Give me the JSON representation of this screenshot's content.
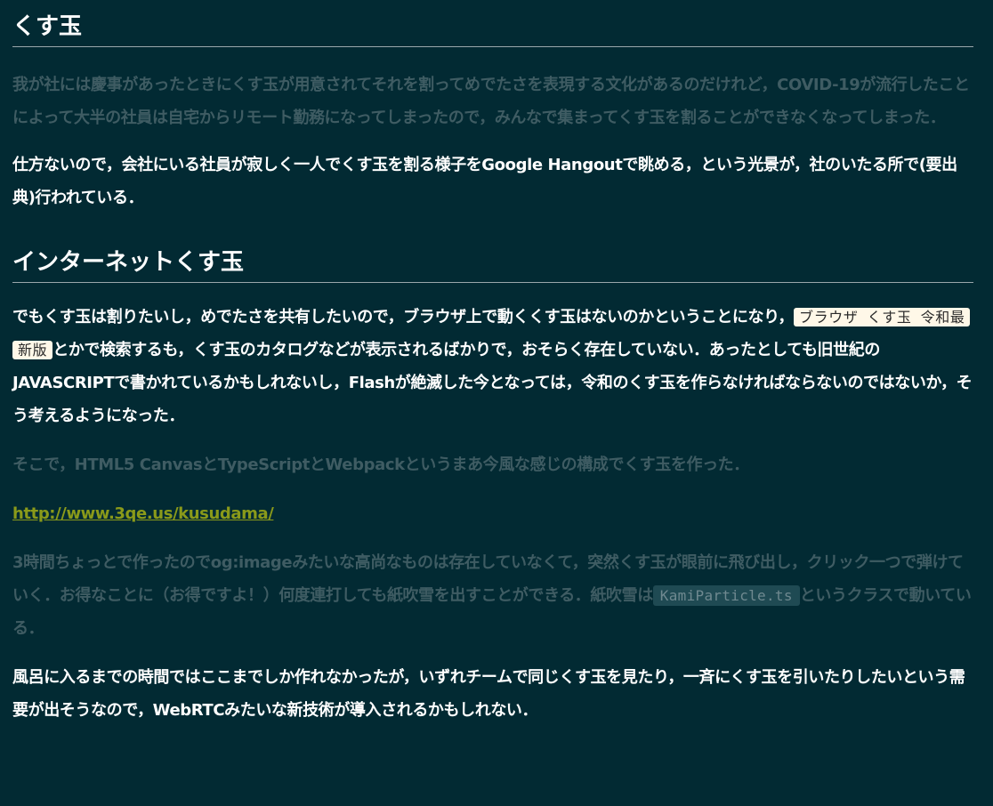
{
  "sections": [
    {
      "heading": "くす玉",
      "paragraphs": [
        "我が社には慶事があったときにくす玉が用意されてそれを割ってめでたさを表現する文化があるのだけれど，COVID-19が流行したことによって大半の社員は自宅からリモート勤務になってしまったので，みんなで集まってくす玉を割ることができなくなってしまった．",
        "仕方ないので，会社にいる社員が寂しく一人でくす玉を割る様子をGoogle Hangoutで眺める，という光景が，社のいたる所で(要出典)行われている．"
      ]
    },
    {
      "heading": "インターネットくす玉",
      "p1_before": "でもくす玉は割りたいし，めでたさを共有したいので，ブラウザ上で動くくす玉はないのかということになり，",
      "p1_code": "ブラウザ くす玉 令和最新版",
      "p1_after": "とかで検索するも，くす玉のカタログなどが表示されるばかりで，おそらく存在していない．あったとしても旧世紀のJAVASCRIPTで書かれているかもしれないし，Flashが絶滅した今となっては，令和のくす玉を作らなければならないのではないか，そう考えるようになった．",
      "p2": "そこで，HTML5 CanvasとTypeScriptとWebpackというまあ今風な感じの構成でくす玉を作った．",
      "link": "http://www.3qe.us/kusudama/",
      "p3_before": "3時間ちょっとで作ったのでog:imageみたいな高尚なものは存在していなくて，突然くす玉が眼前に飛び出し，クリック一つで弾けていく．お得なことに（お得ですよ！）何度連打しても紙吹雪を出すことができる．紙吹雪は",
      "p3_code": "KamiParticle.ts",
      "p3_after": "というクラスで動いている．",
      "p4": "風呂に入るまでの時間ではここまでしか作れなかったが，いずれチームで同じくす玉を見たり，一斉にくす玉を引いたりしたいという需要が出そうなので，WebRTCみたいな新技術が導入されるかもしれない．"
    }
  ],
  "colors": {
    "background": "#022a33",
    "text_bright": "#ffffff",
    "text_dim": "#3f5c63",
    "link": "#8a9a1a",
    "code_light_bg": "#fff8e8",
    "code_dark_bg": "#1f4a53"
  }
}
